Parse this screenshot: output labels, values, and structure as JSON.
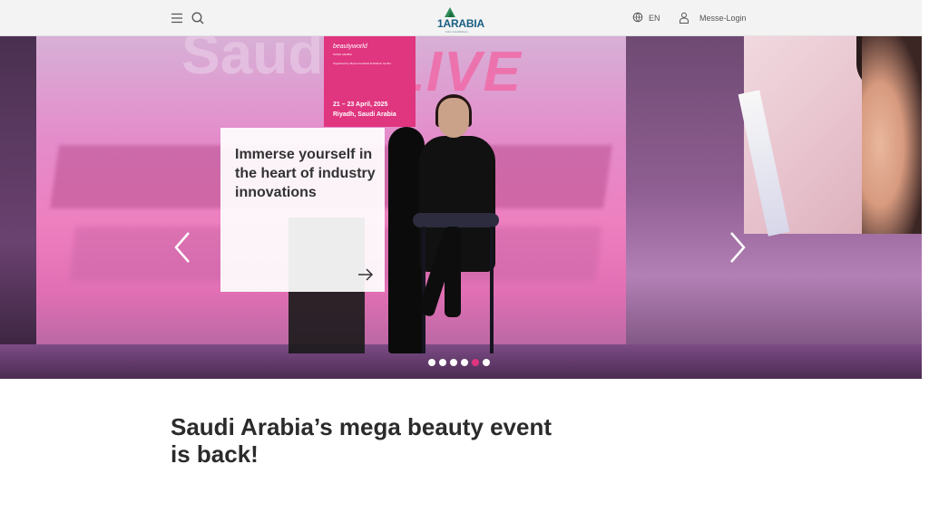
{
  "header": {
    "menu_icon": "hamburger-menu-icon",
    "search_icon": "search-icon",
    "logo_text": "1ARABIA",
    "logo_sub": "Fairs & Exhibitions",
    "language_label": "EN",
    "login_label": "Messe-Login"
  },
  "hero": {
    "poster": {
      "brand": "beautyworld",
      "subtitle": "SAUDI ARABIA",
      "organizer": "Organised by Messe Frankfurt Exhibition GmbH",
      "date": "21 – 23 April, 2025",
      "location": "Riyadh, Saudi Arabia"
    },
    "live_text": "LIVE",
    "card": {
      "text": "Immerse yourself in the heart of industry innovations",
      "arrow_icon": "arrow-right-icon"
    },
    "carousel": {
      "prev_icon": "chevron-left-icon",
      "next_icon": "chevron-right-icon",
      "dots_total": 6,
      "active_dot": 5
    }
  },
  "main": {
    "headline": "Saudi Arabia’s mega beauty event is back!"
  },
  "colors": {
    "accent": "#e0357f",
    "header_bg": "#f3f3f3",
    "text_dark": "#2b2b2b"
  }
}
